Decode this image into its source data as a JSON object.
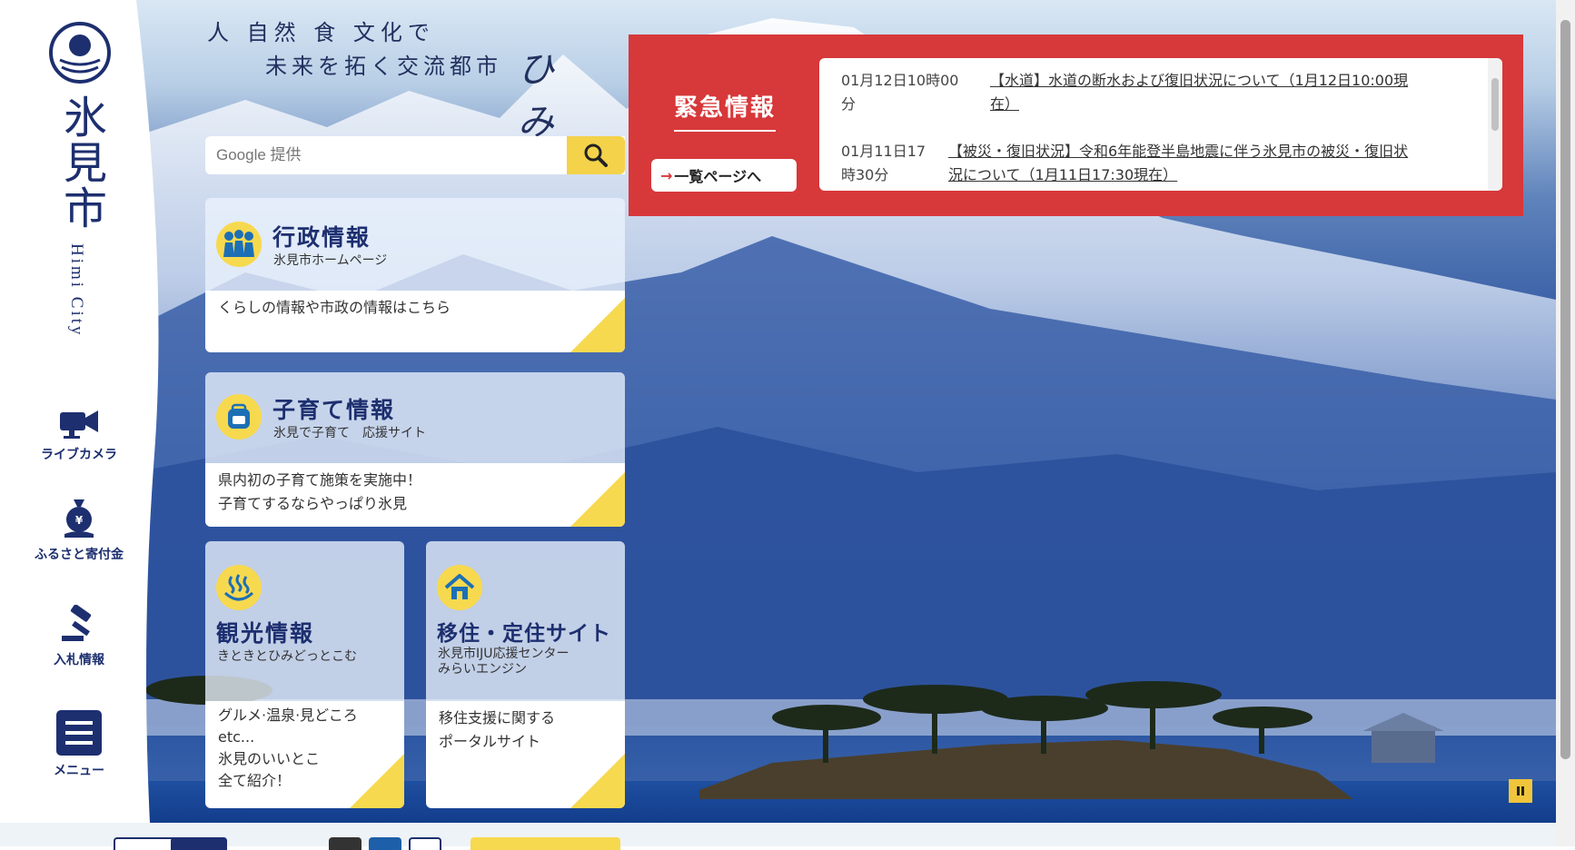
{
  "sidebar": {
    "city_name": "氷見市",
    "city_sub": "Himi City",
    "links": [
      {
        "label": "ライブカメラ",
        "icon": "video-camera-icon"
      },
      {
        "label": "ふるさと寄付金",
        "icon": "donation-bag-icon"
      },
      {
        "label": "入札情報",
        "icon": "gavel-icon"
      },
      {
        "label": "メニュー",
        "icon": "menu-icon"
      }
    ]
  },
  "tagline": {
    "line1": "人 自然 食 文化で",
    "line2": "未来を拓く交流都市",
    "himi": "ひみ"
  },
  "search": {
    "placeholder": "Google 提供"
  },
  "cards": {
    "gyosei": {
      "title": "行政情報",
      "subtitle": "氷見市ホームページ",
      "desc": "くらしの情報や市政の情報はこちら"
    },
    "kosodate": {
      "title": "子育て情報",
      "subtitle": "氷見で子育て　応援サイト",
      "desc1": "県内初の子育て施策を実施中！",
      "desc2": "子育てするならやっぱり氷見"
    },
    "kanko": {
      "title": "観光情報",
      "subtitle": "きときとひみどっとこむ",
      "desc1": "グルメ·温泉·見どころ",
      "desc2": "etc...",
      "desc3": "氷見のいいとこ",
      "desc4": "全て紹介！"
    },
    "iju": {
      "title": "移住・定住サイト",
      "subtitle1": "氷見市IJU応援センター",
      "subtitle2": "みらいエンジン",
      "desc1": "移住支援に関する",
      "desc2": "ポータルサイト"
    }
  },
  "emergency": {
    "heading": "緊急情報",
    "list_button": "一覧ページへ",
    "items": [
      {
        "date1": "01月12日10時00",
        "date2": "分",
        "link1": "【水道】水道の断水および復旧状況について（1月12日10:00現",
        "link2": "在）"
      },
      {
        "date1": "01月11日17",
        "date2": "時30分",
        "link1": "【被災・復旧状況】令和6年能登半島地震に伴う氷見市の被災・復旧状",
        "link2": "況について（1月11日17:30現在）"
      }
    ]
  },
  "colors": {
    "navy": "#1d2f6f",
    "yellow": "#f7d94f",
    "emergency_red": "#d7383a"
  }
}
